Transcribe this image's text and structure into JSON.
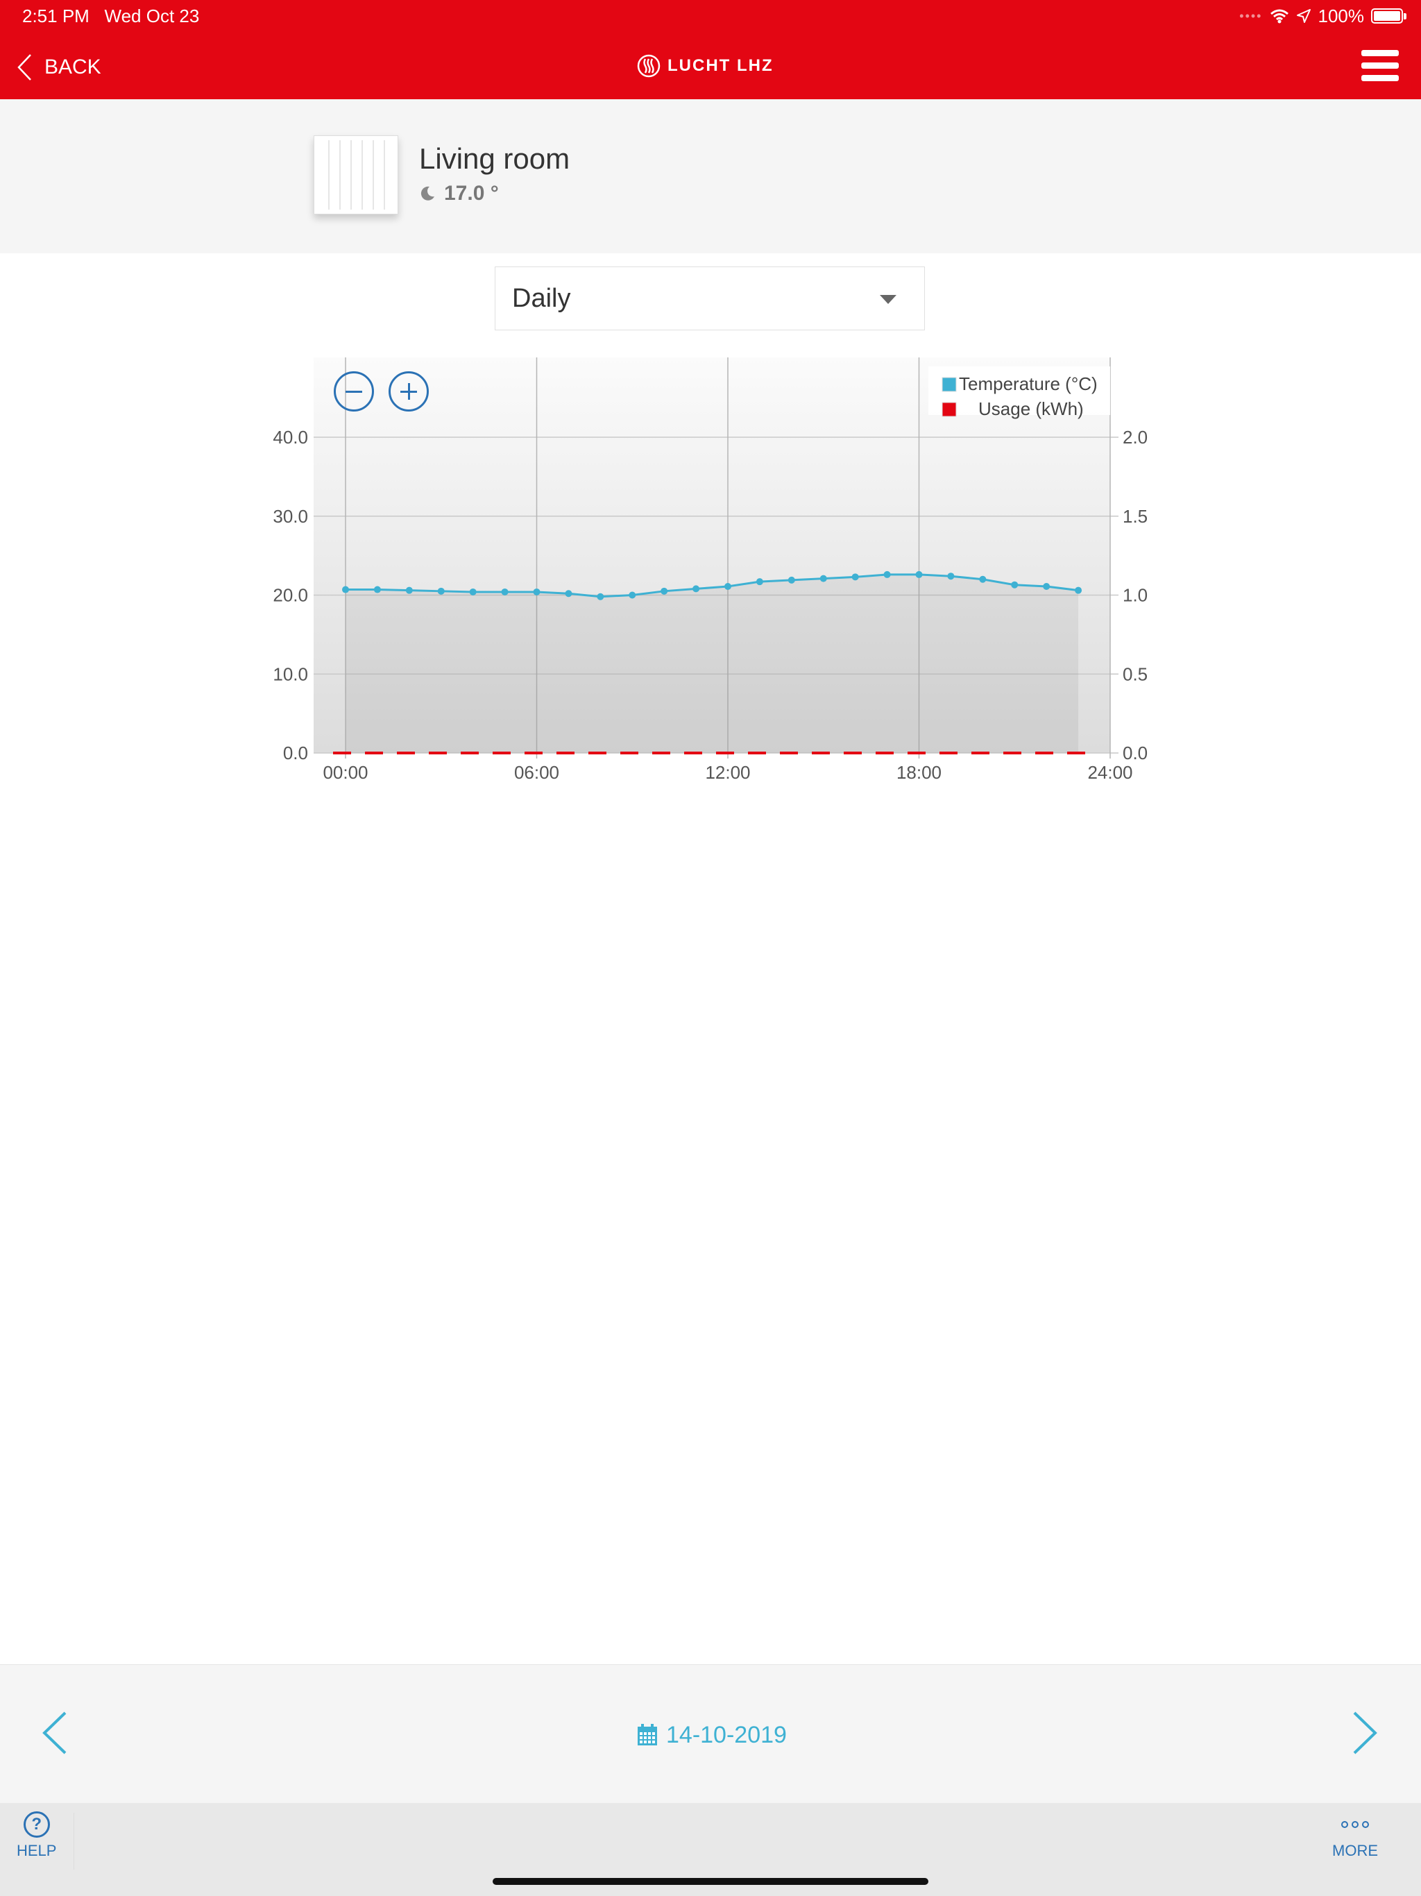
{
  "status_bar": {
    "time": "2:51 PM",
    "date": "Wed Oct 23",
    "battery": "100%",
    "battery_level": 1.0
  },
  "header": {
    "back_label": "BACK",
    "brand": "LUCHT LHZ"
  },
  "room": {
    "name": "Living room",
    "setpoint": "17.0 °"
  },
  "period_select": {
    "value": "Daily"
  },
  "chart_data": {
    "type": "line",
    "legend": [
      {
        "name": "Temperature (°C)",
        "color": "#3eb1d3"
      },
      {
        "name": "Usage (kWh)",
        "color": "#e30613"
      }
    ],
    "x_ticks": [
      "00:00",
      "06:00",
      "12:00",
      "18:00",
      "24:00"
    ],
    "y_left_ticks": [
      "0.0",
      "10.0",
      "20.0",
      "30.0",
      "40.0"
    ],
    "y_right_ticks": [
      "0.0",
      "0.5",
      "1.0",
      "1.5",
      "2.0"
    ],
    "y_left_range": [
      0,
      40
    ],
    "y_right_range": [
      0,
      2
    ],
    "x_range_hours": [
      0,
      24
    ],
    "legend_position": "top-right",
    "grid": true,
    "series": [
      {
        "name": "Temperature (°C)",
        "axis": "left",
        "x": [
          0,
          1,
          2,
          3,
          4,
          5,
          6,
          7,
          8,
          9,
          10,
          11,
          12,
          13,
          14,
          15,
          16,
          17,
          18,
          19,
          20,
          21,
          22,
          23
        ],
        "values": [
          20.7,
          20.7,
          20.6,
          20.5,
          20.4,
          20.4,
          20.4,
          20.2,
          19.8,
          20.0,
          20.5,
          20.8,
          21.1,
          21.7,
          21.9,
          22.1,
          22.3,
          22.6,
          22.6,
          22.4,
          22.0,
          21.3,
          21.1,
          20.6
        ]
      },
      {
        "name": "Usage (kWh)",
        "axis": "right",
        "x": [
          0,
          1,
          2,
          3,
          4,
          5,
          6,
          7,
          8,
          9,
          10,
          11,
          12,
          13,
          14,
          15,
          16,
          17,
          18,
          19,
          20,
          21,
          22,
          23
        ],
        "values": [
          0,
          0,
          0,
          0,
          0,
          0,
          0,
          0,
          0,
          0,
          0,
          0,
          0,
          0,
          0,
          0,
          0,
          0,
          0,
          0,
          0,
          0,
          0,
          0
        ]
      }
    ]
  },
  "footer": {
    "date": "14-10-2019"
  },
  "tabbar": {
    "help_label": "HELP",
    "more_label": "MORE"
  },
  "colors": {
    "brand_red": "#e30613",
    "accent_blue": "#3eb1d3",
    "link_blue": "#2b72b5"
  }
}
